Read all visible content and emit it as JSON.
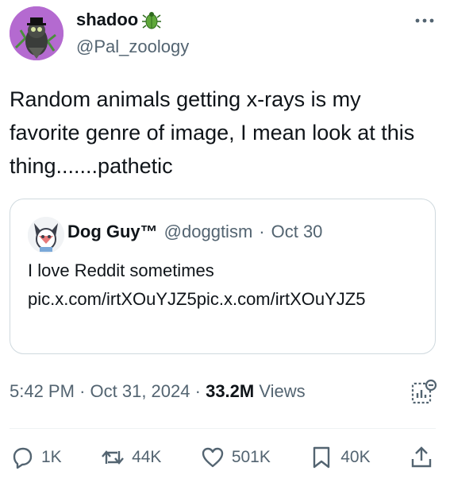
{
  "author": {
    "display_name": "shadoo",
    "handle": "@Pal_zoology",
    "avatar": "avatar-owl-icon",
    "name_emoji": "beetle-icon"
  },
  "tweet": {
    "text": "Random animals getting x-rays is my favorite genre of image, I mean look at this thing.......pathetic"
  },
  "quote": {
    "display_name": "Dog Guy™",
    "handle": "@doggtism",
    "separator": "·",
    "date": "Oct 30",
    "text_line1": "I love Reddit sometimes",
    "text_link": "pic.x.com/irtXOuYJZ5pic.x.com/irtXOuYJZ5"
  },
  "meta": {
    "time": "5:42 PM",
    "date": "Oct 31, 2024",
    "views_count": "33.2M",
    "views_label": "Views"
  },
  "actions": {
    "replies": "1K",
    "reposts": "44K",
    "likes": "501K",
    "bookmarks": "40K"
  },
  "colors": {
    "avatar_bg": "#b46ad0",
    "secondary_text": "#536471",
    "border": "#cfd9de"
  }
}
